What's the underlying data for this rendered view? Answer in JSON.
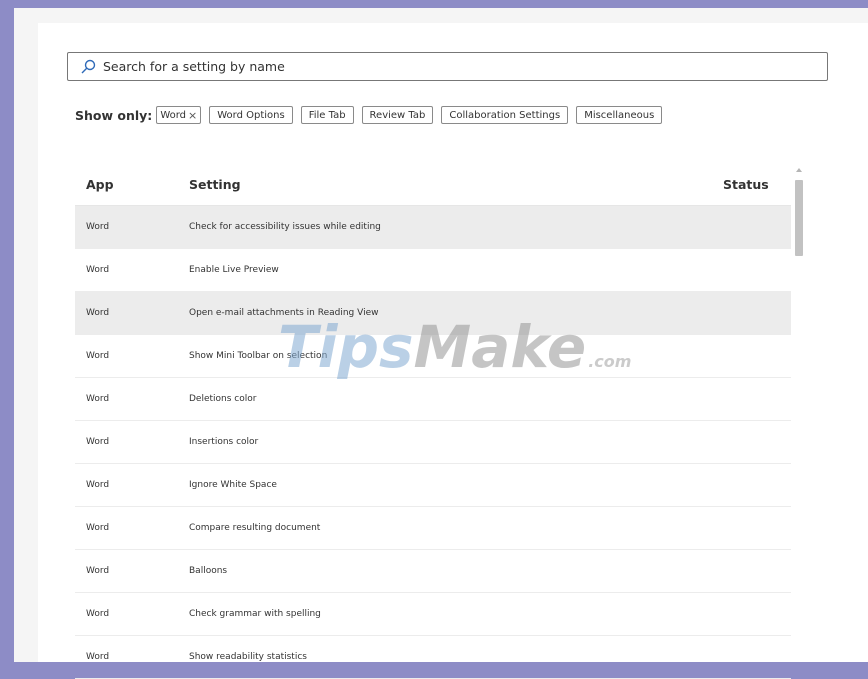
{
  "search": {
    "placeholder": "Search for a setting by name"
  },
  "filters": {
    "label": "Show only:",
    "chips": [
      {
        "label": "Word",
        "removable": true
      },
      {
        "label": "Word Options"
      },
      {
        "label": "File Tab"
      },
      {
        "label": "Review Tab"
      },
      {
        "label": "Collaboration Settings"
      },
      {
        "label": "Miscellaneous"
      }
    ],
    "remove_glyph": "×"
  },
  "table": {
    "headers": {
      "app": "App",
      "setting": "Setting",
      "status": "Status"
    },
    "rows": [
      {
        "app": "Word",
        "setting": "Check for accessibility issues while editing",
        "status": ""
      },
      {
        "app": "Word",
        "setting": "Enable Live Preview",
        "status": ""
      },
      {
        "app": "Word",
        "setting": "Open e-mail attachments in Reading View",
        "status": ""
      },
      {
        "app": "Word",
        "setting": "Show Mini Toolbar on selection",
        "status": ""
      },
      {
        "app": "Word",
        "setting": "Deletions color",
        "status": ""
      },
      {
        "app": "Word",
        "setting": "Insertions color",
        "status": ""
      },
      {
        "app": "Word",
        "setting": "Ignore White Space",
        "status": ""
      },
      {
        "app": "Word",
        "setting": "Compare resulting document",
        "status": ""
      },
      {
        "app": "Word",
        "setting": "Balloons",
        "status": ""
      },
      {
        "app": "Word",
        "setting": "Check grammar with spelling",
        "status": ""
      },
      {
        "app": "Word",
        "setting": "Show readability statistics",
        "status": ""
      }
    ]
  },
  "watermark": {
    "part1": "Tips",
    "part2": "Make",
    "part3": ".com"
  },
  "colors": {
    "frame": "#8d8cc6",
    "row_shade": "#ececec",
    "search_icon": "#2f6ab8"
  }
}
